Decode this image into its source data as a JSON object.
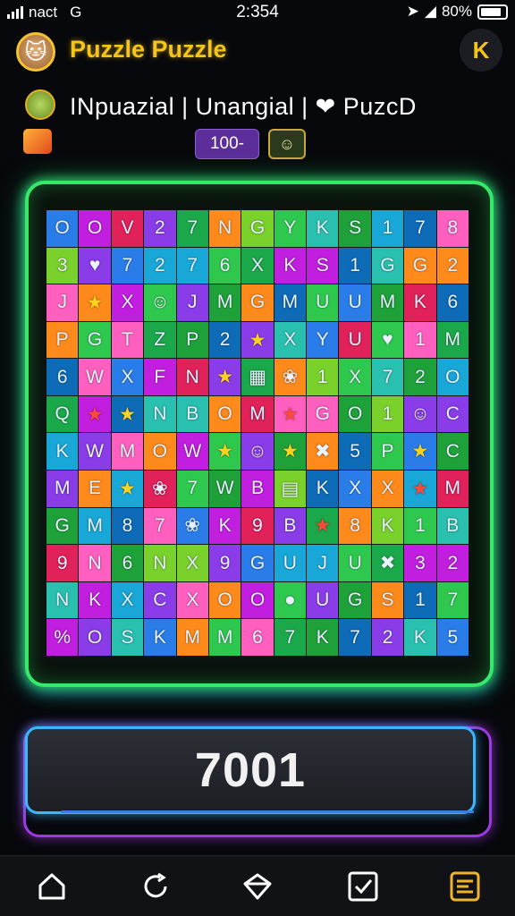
{
  "status_bar": {
    "carrier": "nact",
    "network": "G",
    "time": "2:354",
    "battery": "80%"
  },
  "header": {
    "title": "Puzzle Puzzle",
    "corner_label": "K"
  },
  "subtitle": {
    "text": "INpuazial | Unangial | ❤ PuzcD"
  },
  "badges": {
    "count": "100-",
    "icon_label": "☺"
  },
  "board": {
    "rows": [
      [
        "O",
        "O",
        "V",
        "2",
        "7",
        "N",
        "G",
        "Y",
        "K",
        "S",
        "1",
        "7",
        "8"
      ],
      [
        "3",
        "♥",
        "7",
        "2",
        "7",
        "6",
        "X",
        "K",
        "S",
        "1",
        "G",
        "G",
        "2"
      ],
      [
        "J",
        "★",
        "X",
        "☺",
        "J",
        "M",
        "G",
        "M",
        "U",
        "U",
        "M",
        "K",
        "6"
      ],
      [
        "P",
        "G",
        "T",
        "Z",
        "P",
        "2",
        "★",
        "X",
        "Y",
        "U",
        "♥",
        "1",
        "M"
      ],
      [
        "6",
        "W",
        "X",
        "F",
        "N",
        "★",
        "▦",
        "❀",
        "1",
        "X",
        "7",
        "2",
        "O"
      ],
      [
        "Q",
        "★",
        "★",
        "N",
        "B",
        "O",
        "M",
        "★",
        "G",
        "O",
        "1",
        "☺",
        "C"
      ],
      [
        "K",
        "W",
        "M",
        "O",
        "W",
        "★",
        "☺",
        "★",
        "✖",
        "5",
        "P",
        "★",
        "C"
      ],
      [
        "M",
        "E",
        "★",
        "❀",
        "7",
        "W",
        "B",
        "▤",
        "K",
        "X",
        "X",
        "★",
        "M"
      ],
      [
        "G",
        "M",
        "8",
        "7",
        "❀",
        "K",
        "9",
        "B",
        "★",
        "8",
        "K",
        "1",
        "B"
      ],
      [
        "9",
        "N",
        "6",
        "N",
        "X",
        "9",
        "G",
        "U",
        "J",
        "U",
        "✖",
        "3",
        "2"
      ],
      [
        "N",
        "K",
        "X",
        "C",
        "X",
        "O",
        "O",
        "●",
        "U",
        "G",
        "S",
        "1",
        "7"
      ],
      [
        "%",
        "O",
        "S",
        "K",
        "M",
        "M",
        "6",
        "7",
        "K",
        "7",
        "2",
        "K",
        "5"
      ]
    ]
  },
  "score": {
    "value": "7001"
  },
  "nav": {
    "items": [
      "home",
      "refresh",
      "shop",
      "tasks",
      "menu"
    ]
  }
}
